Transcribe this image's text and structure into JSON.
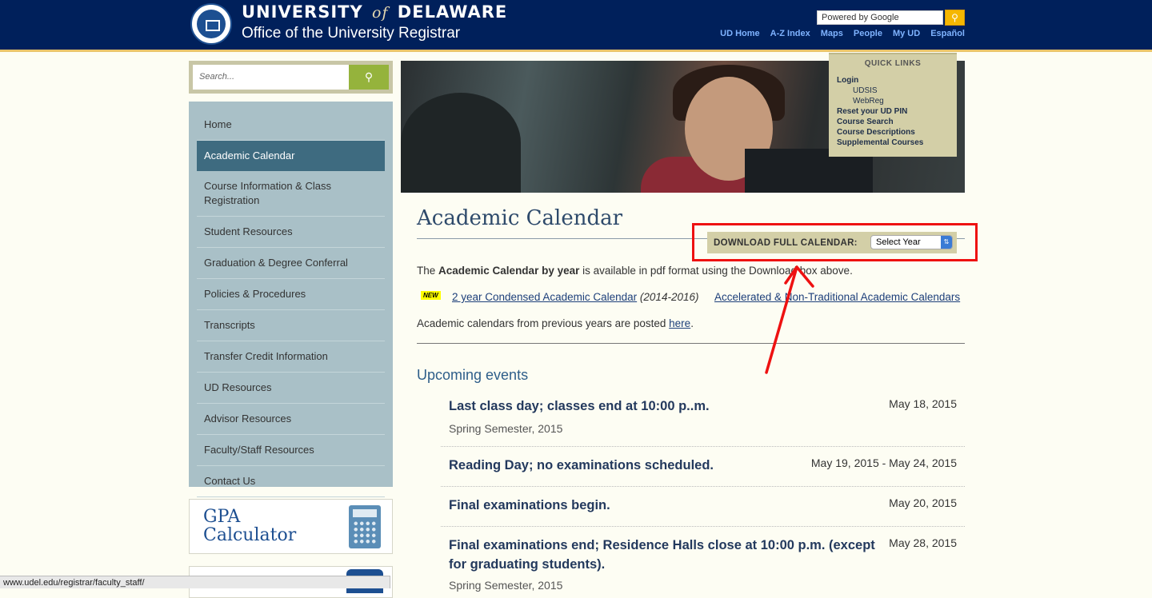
{
  "header": {
    "uni_name_1": "UNIVERSITY",
    "uni_name_of": "of",
    "uni_name_2": "DELAWARE",
    "office": "Office of the University Registrar",
    "search_placeholder": "Powered by Google",
    "links": [
      "UD Home",
      "A-Z Index",
      "Maps",
      "People",
      "My UD",
      "Español"
    ]
  },
  "sidebar": {
    "search_placeholder": "Search...",
    "items": [
      "Home",
      "Academic Calendar",
      "Course Information & Class Registration",
      "Student Resources",
      "Graduation & Degree Conferral",
      "Policies & Procedures",
      "Transcripts",
      "Transfer Credit Information",
      "UD Resources",
      "Advisor Resources",
      "Faculty/Staff Resources",
      "Contact Us"
    ],
    "active_index": 1,
    "gpa_line1": "GPA",
    "gpa_line2": "Calculator"
  },
  "quick_links": {
    "title": "QUICK LINKS",
    "login": "Login",
    "udsis": "UDSIS",
    "webreg": "WebReg",
    "reset": "Reset your UD PIN",
    "course_search": "Course Search",
    "course_desc": "Course Descriptions",
    "supplemental": "Supplemental Courses"
  },
  "main": {
    "title": "Academic Calendar",
    "download_label": "DOWNLOAD FULL CALENDAR:",
    "select_value": "Select Year",
    "intro_pre": "The ",
    "intro_bold": "Academic Calendar by year",
    "intro_post": " is available in pdf format using the Download box above.",
    "new_badge": "NEW",
    "link1_text": "2 year Condensed Academic Calendar",
    "link1_suffix": "(2014-2016)",
    "link2_text": "Accelerated & Non-Traditional Academic Calendars",
    "prev_text": "Academic calendars from previous years are posted ",
    "prev_link": "here",
    "prev_end": ".",
    "events_title": "Upcoming events",
    "events": [
      {
        "title": "Last class day; classes end at 10:00 p..m.",
        "date": "May 18, 2015",
        "sub": "Spring Semester, 2015"
      },
      {
        "title": "Reading Day; no examinations scheduled.",
        "date": "May 19, 2015 - May 24, 2015",
        "sub": ""
      },
      {
        "title": "Final examinations begin.",
        "date": "May 20, 2015",
        "sub": ""
      },
      {
        "title": "Final examinations end; Residence Halls close at 10:00 p.m. (except for graduating students).",
        "date": "May 28, 2015",
        "sub": "Spring Semester, 2015"
      }
    ]
  },
  "status_bar": "www.udel.edu/registrar/faculty_staff/",
  "colors": {
    "header_bg": "#00205b",
    "annotation_red": "#e11",
    "nav_active": "#3e6b80"
  }
}
